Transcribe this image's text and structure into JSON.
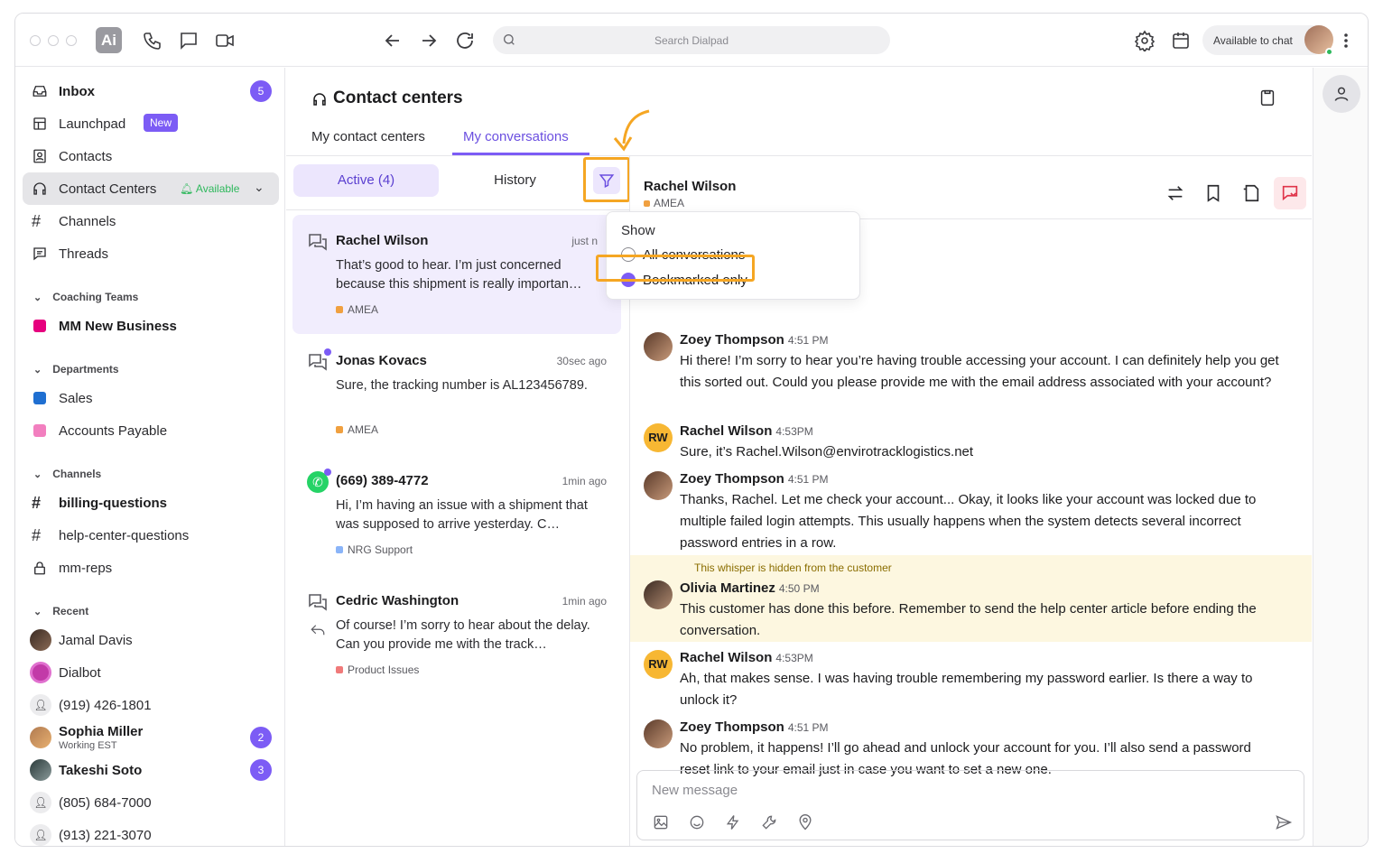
{
  "search": {
    "placeholder": "Search Dialpad"
  },
  "status": {
    "label": "Available to chat"
  },
  "sidebar": {
    "inbox": {
      "label": "Inbox",
      "count": "5"
    },
    "launchpad": {
      "label": "Launchpad",
      "badge": "New"
    },
    "contacts": {
      "label": "Contacts"
    },
    "contact_centers": {
      "label": "Contact Centers",
      "status": "Available"
    },
    "channels_item": {
      "label": "Channels"
    },
    "threads": {
      "label": "Threads"
    },
    "coaching": {
      "title": "Coaching Teams",
      "items": [
        {
          "label": "MM New Business",
          "color": "#e6007e"
        }
      ]
    },
    "departments": {
      "title": "Departments",
      "items": [
        {
          "label": "Sales",
          "color": "#1f6fd1"
        },
        {
          "label": "Accounts Payable",
          "color": "#f27fbf"
        }
      ]
    },
    "channels": {
      "title": "Channels",
      "items": [
        {
          "label": "billing-questions"
        },
        {
          "label": "help-center-questions"
        },
        {
          "label": "mm-reps"
        }
      ]
    },
    "recent": {
      "title": "Recent",
      "items": [
        {
          "label": "Jamal Davis"
        },
        {
          "label": "Dialbot"
        },
        {
          "label": "(919) 426-1801"
        },
        {
          "label": "Sophia Miller",
          "sub": "Working EST",
          "count": "2"
        },
        {
          "label": "Takeshi Soto",
          "count": "3"
        },
        {
          "label": "(805) 684-7000"
        },
        {
          "label": "(913) 221-3070"
        }
      ]
    }
  },
  "page": {
    "title": "Contact centers",
    "tabs": [
      "My contact centers",
      "My conversations"
    ]
  },
  "filters": {
    "active": "Active (4)",
    "history": "History"
  },
  "conversations": [
    {
      "name": "Rachel Wilson",
      "time": "just n",
      "preview": "That’s good to hear. I’m just concerned because this shipment is really importan…",
      "tag": "AMEA",
      "tag_color": "#f0a040"
    },
    {
      "name": "Jonas Kovacs",
      "time": "30sec ago",
      "preview": "Sure, the tracking number is AL123456789.",
      "tag": "AMEA",
      "tag_color": "#f0a040"
    },
    {
      "name": "(669) 389-4772",
      "time": "1min ago",
      "preview": "Hi, I’m having an issue with a shipment that was supposed to arrive yesterday. C…",
      "tag": "NRG Support",
      "tag_color": "#8ab4f8"
    },
    {
      "name": "Cedric Washington",
      "time": "1min ago",
      "preview": "Of course! I’m sorry to hear about the delay. Can you provide me with the track…",
      "tag": "Product Issues",
      "tag_color": "#f07a7a"
    }
  ],
  "popup": {
    "title": "Show",
    "options": [
      "All conversations",
      "Bookmarked only"
    ],
    "selected": "Bookmarked only"
  },
  "chat": {
    "contact": "Rachel Wilson",
    "tag": "AMEA",
    "messages": [
      {
        "name": "Zoey Thompson",
        "time": "4:51 PM",
        "text": "Hi there! I’m sorry to hear you’re having trouble accessing your account. I can definitely help you get this sorted out. Could you please provide me with the email address associated with your account?"
      },
      {
        "name": "Rachel Wilson",
        "initials": "RW",
        "time": "4:53PM",
        "text": "Sure, it’s Rachel.Wilson@envirotracklogistics.net"
      },
      {
        "name": "Zoey Thompson",
        "time": "4:51 PM",
        "text": "Thanks, Rachel. Let me check your account... Okay, it looks like your account was locked due to multiple failed login attempts. This usually happens when the system detects several incorrect password entries in a row."
      },
      {
        "name": "Olivia Martinez",
        "time": "4:50 PM",
        "whisper": "This whisper is hidden from the customer",
        "text": "This customer has done this before. Remember to send the help center article before ending the conversation."
      },
      {
        "name": "Rachel Wilson",
        "initials": "RW",
        "time": "4:53PM",
        "text": "Ah, that makes sense. I was having trouble remembering my password earlier. Is there a way to unlock it?"
      },
      {
        "name": "Zoey Thompson",
        "time": "4:51 PM",
        "text": "No problem, it happens! I’ll go ahead and unlock your account for you. I’ll also send a password reset link to your email just in case you want to set a new one."
      }
    ]
  },
  "composer": {
    "placeholder": "New message"
  }
}
